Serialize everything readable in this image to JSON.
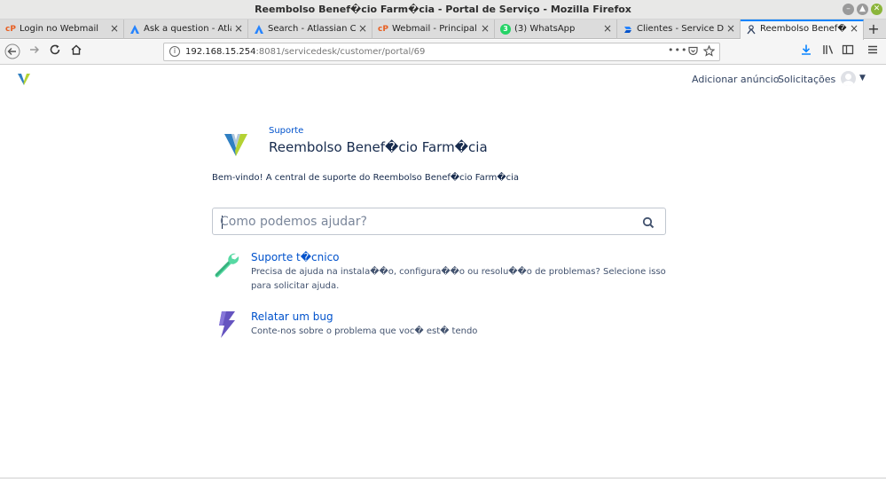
{
  "window": {
    "title": "Reembolso Benef�cio Farm�cia - Portal de Serviço - Mozilla Firefox"
  },
  "tabs": [
    {
      "label": "Login no Webmail",
      "icon": "cpanel-icon",
      "active": false
    },
    {
      "label": "Ask a question - Atlassian",
      "icon": "atlassian-icon",
      "active": false
    },
    {
      "label": "Search - Atlassian Community",
      "icon": "atlassian-icon",
      "active": false
    },
    {
      "label": "Webmail - Principal",
      "icon": "cpanel-icon",
      "active": false
    },
    {
      "label": "(3) WhatsApp",
      "icon": "whatsapp-icon",
      "badge": "3",
      "active": false
    },
    {
      "label": "Clientes - Service Desk",
      "icon": "jira-icon",
      "active": false
    },
    {
      "label": "Reembolso Benef�cio",
      "icon": "portal-icon",
      "active": true
    }
  ],
  "navbar": {
    "url_host": "192.168.15.254",
    "url_rest": ":8081/servicedesk/customer/portal/69"
  },
  "header": {
    "add_ad": "Adicionar anúncio",
    "requests": "Solicitações"
  },
  "portal": {
    "breadcrumb": "Suporte",
    "title": "Reembolso Benef�cio Farm�cia",
    "welcome": "Bem-vindo! A central de suporte do Reembolso Benef�cio Farm�cia",
    "search_placeholder": "Como podemos ajudar?"
  },
  "request_types": [
    {
      "title": "Suporte t�cnico",
      "description": "Precisa de ajuda na instala��o, configura��o ou resolu��o de problemas? Selecione isso para solicitar ajuda.",
      "icon": "wrench-icon"
    },
    {
      "title": "Relatar um bug",
      "description": "Conte-nos sobre o problema que voc� est� tendo",
      "icon": "lightning-icon"
    }
  ],
  "colors": {
    "link": "#0052cc",
    "text": "#172b4d",
    "wrench": "#57d9a3",
    "bolt": "#6554c0",
    "logo_left": "#2f7fc2",
    "logo_right": "#b4d233"
  }
}
